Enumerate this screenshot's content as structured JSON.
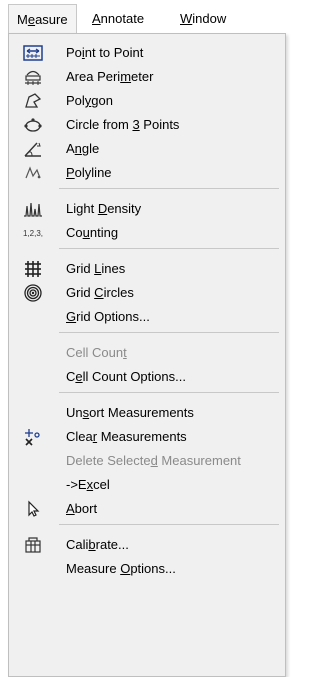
{
  "menubar": {
    "measure": {
      "pre": "M",
      "acc": "e",
      "post": "asure"
    },
    "annotate": {
      "pre": "",
      "acc": "A",
      "post": "nnotate"
    },
    "window": {
      "pre": "",
      "acc": "W",
      "post": "indow"
    }
  },
  "menu": {
    "point_to_point": {
      "pre": "Po",
      "acc": "i",
      "post": "nt to Point",
      "icon": "point-to-point-icon"
    },
    "area_perimeter": {
      "pre": "Area Peri",
      "acc": "m",
      "post": "eter",
      "icon": "area-perimeter-icon"
    },
    "polygon": {
      "pre": "Pol",
      "acc": "y",
      "post": "gon",
      "icon": "polygon-icon"
    },
    "circle_3pts": {
      "pre": "Circle from ",
      "acc": "3",
      "post": " Points",
      "icon": "circle-three-points-icon"
    },
    "angle": {
      "pre": "A",
      "acc": "n",
      "post": "gle",
      "icon": "angle-icon"
    },
    "polyline": {
      "pre": "",
      "acc": "P",
      "post": "olyline",
      "icon": "polyline-icon"
    },
    "light_density": {
      "pre": "Light ",
      "acc": "D",
      "post": "ensity",
      "icon": "light-density-icon"
    },
    "counting": {
      "pre": "Co",
      "acc": "u",
      "post": "nting",
      "icon": "counting-icon",
      "icon_text": "1,2,3,"
    },
    "grid_lines": {
      "pre": "Grid ",
      "acc": "L",
      "post": "ines",
      "icon": "grid-lines-icon"
    },
    "grid_circles": {
      "pre": "Grid ",
      "acc": "C",
      "post": "ircles",
      "icon": "grid-circles-icon"
    },
    "grid_options": {
      "pre": "",
      "acc": "G",
      "post": "rid Options..."
    },
    "cell_count": {
      "pre": "Cell Coun",
      "acc": "t",
      "post": ""
    },
    "cell_count_options": {
      "pre": "C",
      "acc": "e",
      "post": "ll Count Options..."
    },
    "unsort": {
      "pre": "Un",
      "acc": "s",
      "post": "ort Measurements"
    },
    "clear": {
      "pre": "Clea",
      "acc": "r",
      "post": " Measurements",
      "icon": "clear-measurements-icon"
    },
    "delete_selected": {
      "pre": "Delete Selecte",
      "acc": "d",
      "post": " Measurement"
    },
    "excel": {
      "pre": "->E",
      "acc": "x",
      "post": "cel"
    },
    "abort": {
      "pre": "",
      "acc": "A",
      "post": "bort",
      "icon": "cursor-arrow-icon"
    },
    "calibrate": {
      "pre": "Cali",
      "acc": "b",
      "post": "rate...",
      "icon": "calibrate-icon"
    },
    "measure_options": {
      "pre": "Measure ",
      "acc": "O",
      "post": "ptions..."
    }
  }
}
